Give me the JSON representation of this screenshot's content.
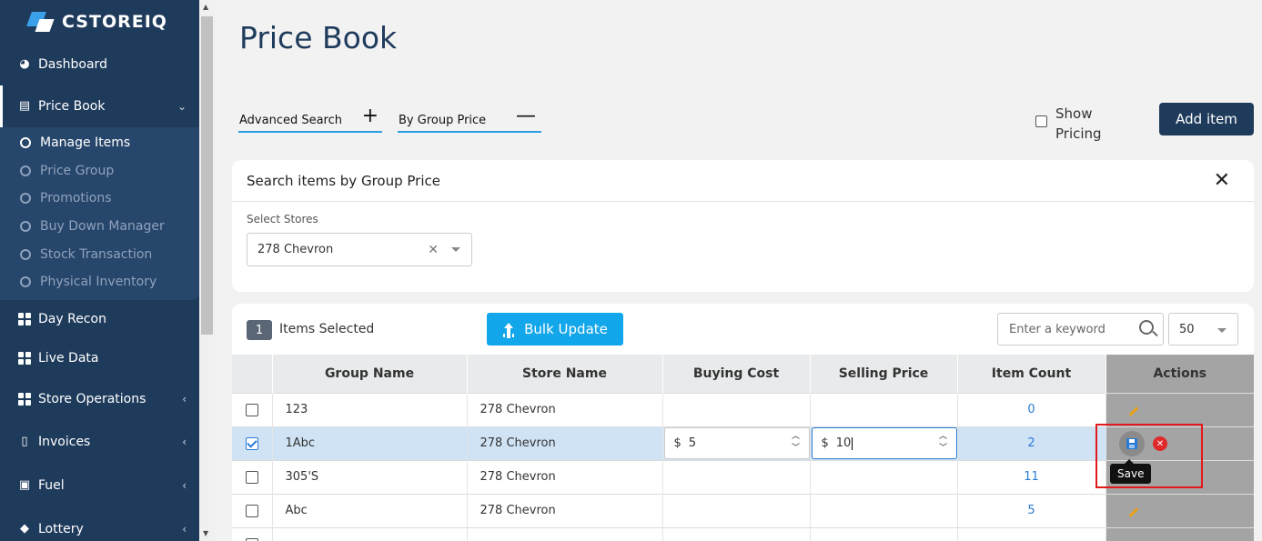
{
  "brand": {
    "name": "CSTOREIQ"
  },
  "sidebar": {
    "items": [
      {
        "label": "Dashboard",
        "icon": "dashboard-icon"
      },
      {
        "label": "Price Book",
        "icon": "book-icon",
        "chevron": "⌄"
      },
      {
        "label": "Day Recon",
        "icon": "grid-icon"
      },
      {
        "label": "Live Data",
        "icon": "grid-icon"
      },
      {
        "label": "Store Operations",
        "icon": "grid-icon",
        "chevron": "‹"
      },
      {
        "label": "Invoices",
        "icon": "invoice-icon",
        "chevron": "‹"
      },
      {
        "label": "Fuel",
        "icon": "fuel-icon",
        "chevron": "‹"
      },
      {
        "label": "Lottery",
        "icon": "lottery-icon",
        "chevron": "‹"
      }
    ],
    "submenu": [
      {
        "label": "Manage Items"
      },
      {
        "label": "Price Group"
      },
      {
        "label": "Promotions"
      },
      {
        "label": "Buy Down Manager"
      },
      {
        "label": "Stock Transaction"
      },
      {
        "label": "Physical Inventory"
      }
    ]
  },
  "page": {
    "title": "Price Book",
    "advanced_search": "Advanced Search",
    "by_group_price": "By Group Price",
    "show_pricing": "Show Pricing",
    "add_item": "Add item"
  },
  "search": {
    "title": "Search items by Group Price",
    "select_stores_label": "Select Stores",
    "selected_store": "278 Chevron"
  },
  "table": {
    "selected_count": "1",
    "selected_text": "Items Selected",
    "bulk_update": "Bulk Update",
    "keyword_placeholder": "Enter a keyword",
    "per_page": "50",
    "columns": [
      "Group Name",
      "Store Name",
      "Buying Cost",
      "Selling Price",
      "Item Count",
      "Actions"
    ],
    "rows": [
      {
        "group": "123",
        "store": "278 Chevron",
        "count": "0"
      },
      {
        "group": "1Abc",
        "store": "278 Chevron",
        "count": "2",
        "buying": "5",
        "selling": "10",
        "currency": "$"
      },
      {
        "group": "305'S",
        "store": "278 Chevron",
        "count": "11"
      },
      {
        "group": "Abc",
        "store": "278 Chevron",
        "count": "5"
      }
    ],
    "tooltip": "Save"
  },
  "colors": {
    "sidebar": "#1f3b5c",
    "accent": "#12a6ea",
    "highlight": "#e0191d"
  }
}
